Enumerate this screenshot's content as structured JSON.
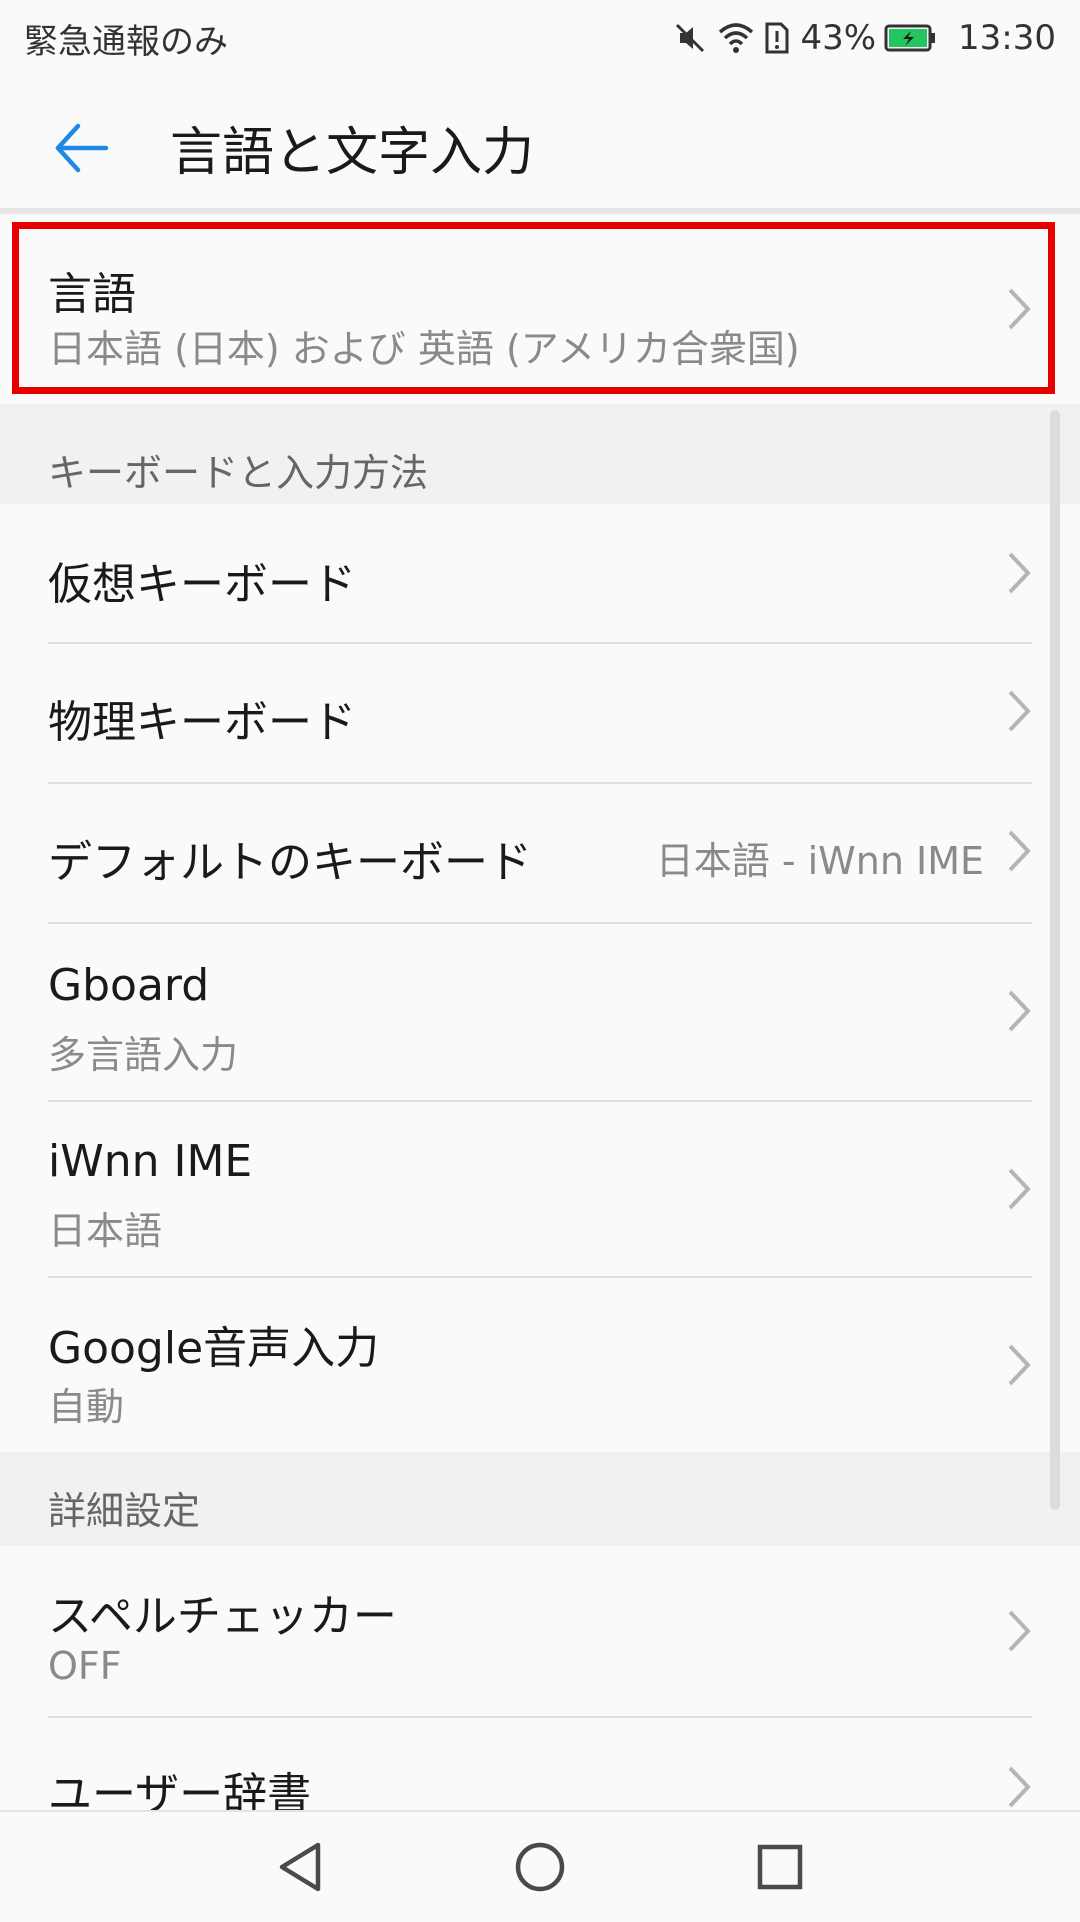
{
  "status_bar": {
    "carrier_text": "緊急通報のみ",
    "battery_percent": "43%",
    "time": "13:30",
    "icons": [
      "mute-icon",
      "wifi-icon",
      "sim-alert-icon",
      "battery-charging-icon"
    ],
    "battery_color": "#22c55e"
  },
  "app_bar": {
    "title": "言語と文字入力",
    "back_icon": "arrow-left-icon",
    "accent_color": "#1e88e5"
  },
  "language": {
    "title": "言語",
    "subtitle": "日本語 (日本) および 英語 (アメリカ合衆国)",
    "highlight_color": "#e60000"
  },
  "sections": {
    "keyboard": "キーボードと入力方法",
    "advanced": "詳細設定"
  },
  "keyboard_items": [
    {
      "title": "仮想キーボード",
      "subtitle": "",
      "value": ""
    },
    {
      "title": "物理キーボード",
      "subtitle": "",
      "value": ""
    },
    {
      "title": "デフォルトのキーボード",
      "subtitle": "",
      "value": "日本語 - iWnn IME"
    },
    {
      "title": "Gboard",
      "subtitle": "多言語入力",
      "value": ""
    },
    {
      "title": "iWnn IME",
      "subtitle": "日本語",
      "value": ""
    },
    {
      "title": "Google音声入力",
      "subtitle": "自動",
      "value": ""
    }
  ],
  "advanced_items": [
    {
      "title": "スペルチェッカー",
      "subtitle": "OFF"
    },
    {
      "title": "ユーザー辞書",
      "subtitle": ""
    }
  ],
  "nav_bar": {
    "buttons": [
      "back-triangle-icon",
      "home-circle-icon",
      "recents-square-icon"
    ]
  }
}
